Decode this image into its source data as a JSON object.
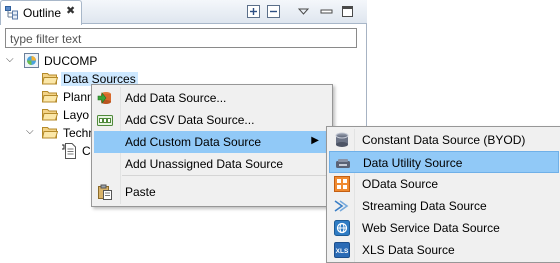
{
  "view": {
    "tab_title": "Outline",
    "tab_close": "✖",
    "filter_placeholder": "type filter text"
  },
  "tree": {
    "root": "DUCOMP",
    "items": [
      {
        "label": "Data Sources",
        "selected": true
      },
      {
        "label": "Plann",
        "selected": false
      },
      {
        "label": "Layo",
        "selected": false
      },
      {
        "label": "Techn",
        "selected": false
      },
      {
        "label": "C",
        "selected": false
      }
    ]
  },
  "context_menu": {
    "items": [
      {
        "label": "Add Data Source...",
        "icon": "add-data-source-icon"
      },
      {
        "label": "Add CSV Data Source...",
        "icon": "csv-icon"
      },
      {
        "label": "Add Custom Data Source",
        "icon": "",
        "submenu_arrow": "▶"
      },
      {
        "label": "Add Unassigned Data Source",
        "icon": ""
      },
      {
        "label": "Paste",
        "icon": "paste-icon"
      }
    ]
  },
  "submenu": {
    "items": [
      {
        "label": "Constant Data Source (BYOD)",
        "icon": "database-icon"
      },
      {
        "label": "Data Utility Source",
        "icon": "data-utility-icon"
      },
      {
        "label": "OData Source",
        "icon": "odata-icon"
      },
      {
        "label": "Streaming Data Source",
        "icon": "streaming-icon"
      },
      {
        "label": "Web Service Data Source",
        "icon": "web-service-icon"
      },
      {
        "label": "XLS Data Source",
        "icon": "xls-icon",
        "icon_text": "XLS"
      }
    ]
  },
  "colors": {
    "highlight": "#91c9f7",
    "selection": "#cde8ff",
    "menu_bg": "#f0f0f0"
  }
}
